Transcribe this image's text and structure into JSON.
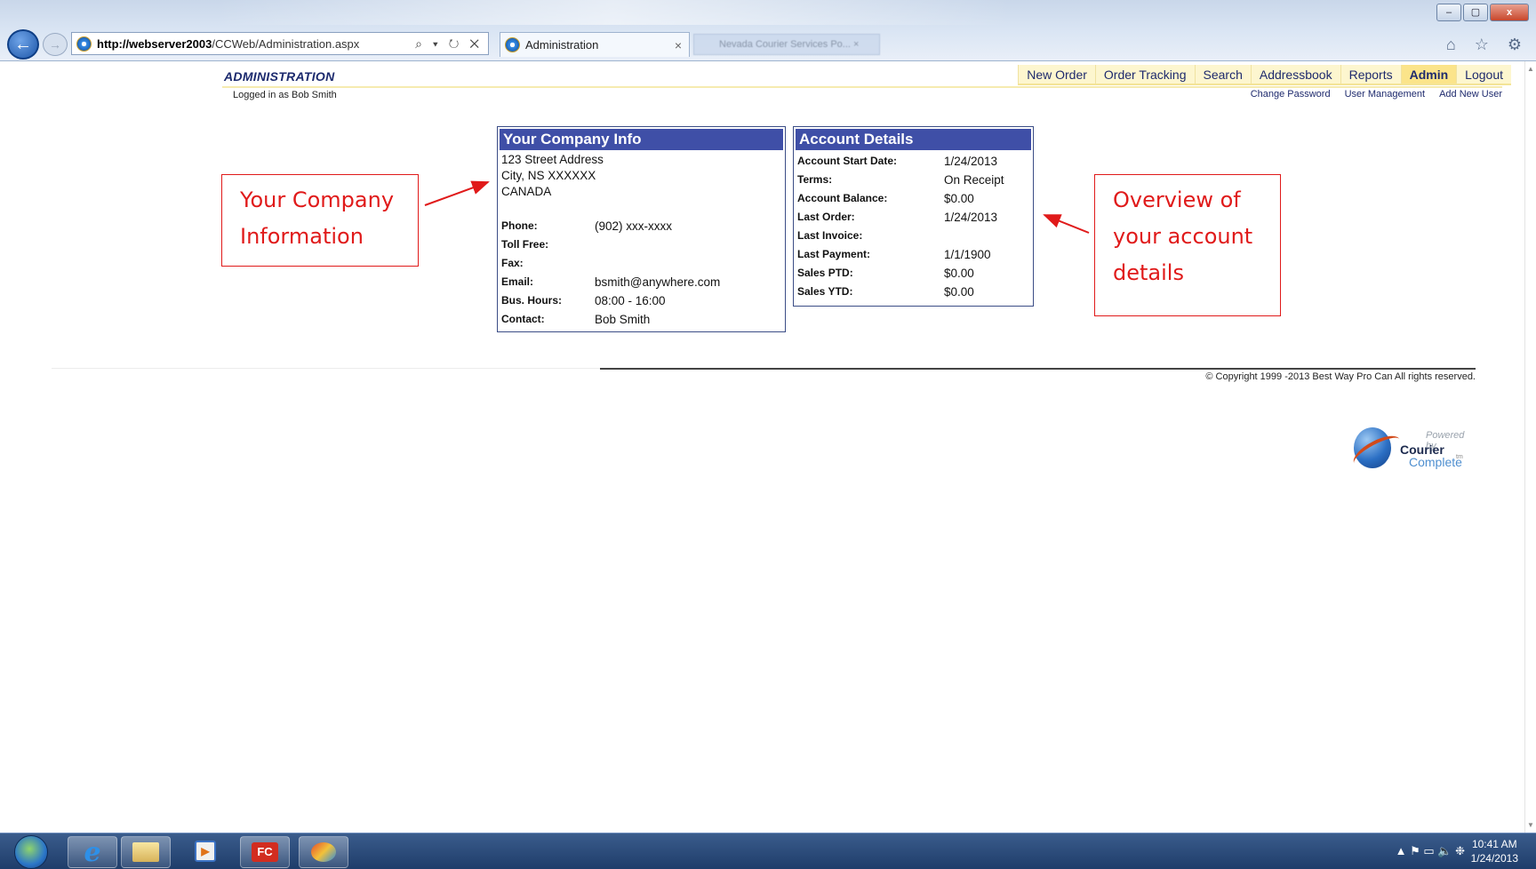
{
  "browser": {
    "url_host": "http://webserver2003",
    "url_path": "/CCWeb/Administration.aspx",
    "address_tools": "⌕ ▾ ↻ ✕",
    "active_tab": "Administration",
    "tab_close": "×",
    "inactive_tab": "Nevada Courier Services Po... ×",
    "minimize": "–",
    "maximize": "▢",
    "close": "x",
    "chrome_icons": "⌂ ☆ ⚙"
  },
  "header": {
    "title": "ADMINISTRATION",
    "logged_in": "Logged in as Bob Smith"
  },
  "topnav": {
    "items": [
      "New Order",
      "Order Tracking",
      "Search",
      "Addressbook",
      "Reports",
      "Admin",
      "Logout"
    ],
    "active": "Admin"
  },
  "subnav": {
    "items": [
      "Change Password",
      "User Management",
      "Add New User"
    ]
  },
  "company": {
    "heading": "Your Company Info",
    "address": [
      "123 Street Address",
      "City, NS   XXXXXX",
      "CANADA"
    ],
    "rows": [
      {
        "label": "Phone:",
        "value": "(902) xxx-xxxx"
      },
      {
        "label": "Toll Free:",
        "value": ""
      },
      {
        "label": "Fax:",
        "value": ""
      },
      {
        "label": "Email:",
        "value": "bsmith@anywhere.com"
      },
      {
        "label": "Bus. Hours:",
        "value": "08:00 - 16:00"
      },
      {
        "label": "Contact:",
        "value": "Bob Smith"
      }
    ]
  },
  "account": {
    "heading": "Account Details",
    "rows": [
      {
        "label": "Account Start Date:",
        "value": "1/24/2013"
      },
      {
        "label": "Terms:",
        "value": "On Receipt"
      },
      {
        "label": "Account Balance:",
        "value": "$0.00"
      },
      {
        "label": "Last Order:",
        "value": "1/24/2013"
      },
      {
        "label": "Last Invoice:",
        "value": ""
      },
      {
        "label": "Last Payment:",
        "value": "1/1/1900"
      },
      {
        "label": "Sales PTD:",
        "value": "$0.00"
      },
      {
        "label": "Sales YTD:",
        "value": "$0.00"
      }
    ]
  },
  "annotations": {
    "left": [
      "Your Company",
      "Information"
    ],
    "right": [
      "Overview of",
      "your account",
      "details"
    ],
    "color": "#e01a1a"
  },
  "footer": {
    "copyright": "© Copyright 1999 -2013 Best Way Pro Can All rights reserved.",
    "powered_by": "Powered by",
    "brand_1": "Courier",
    "brand_2": "Complete",
    "tm": "tm"
  },
  "taskbar": {
    "ie_glyph": "e",
    "media_glyph": "▶",
    "fc_label": "FC",
    "tray": "▲  ⚑  ▭  🔈  ❉",
    "time": "10:41 AM",
    "date": "1/24/2013"
  },
  "colors": {
    "header_blue": "#3f4fa7",
    "nav_bg": "#fdf6cf",
    "nav_active": "#fbe48a",
    "nav_text": "#1e2a6d"
  }
}
